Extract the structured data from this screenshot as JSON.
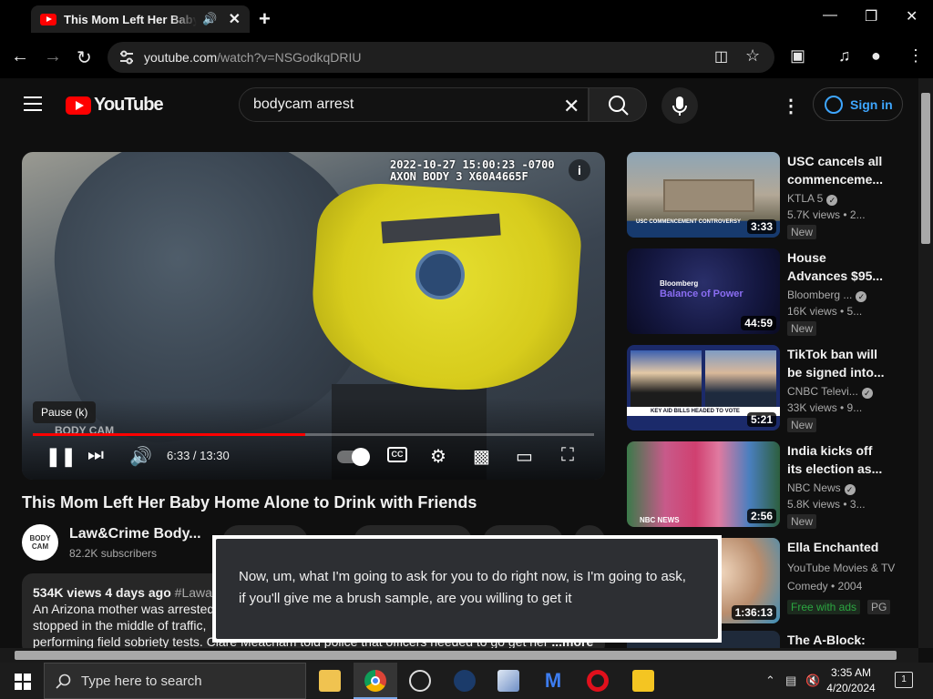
{
  "browser": {
    "tab_title": "This Mom Left Her Baby Home Alone to Drink with Friends",
    "url_host": "youtube.com",
    "url_path": "/watch?v=NSGodkqDRIU"
  },
  "youtube": {
    "logo_text": "YouTube",
    "search_query": "bodycam arrest",
    "sign_in_label": "Sign in"
  },
  "player": {
    "osd_line1": "2022-10-27 15:00:23 -0700",
    "osd_line2": "AXON BODY 3 X60A4665F",
    "tooltip": "Pause (k)",
    "watermark": "BODY CAM",
    "time": "6:33 / 13:30",
    "progress_fraction": 0.485
  },
  "video": {
    "title": "This Mom Left Her Baby Home Alone to Drink with Friends",
    "channel_name": "Law&Crime Body...",
    "channel_subs": "82.2K subscribers",
    "channel_avatar_text": "BODY CAM",
    "desc_meta": "534K views  4 days ago",
    "desc_tag": "#Lawa",
    "desc_line2": "An Arizona mother was arrested",
    "desc_line3": "stopped in the middle of traffic,",
    "desc_line4": "performing field sobriety tests. Clare Meacham told police that officers needed to go get her",
    "desc_more": "...more"
  },
  "caption": {
    "text": "Now, um, what I'm going to ask for you to do right now, is I'm going to ask, if you'll give me a brush sample, are you willing to get it"
  },
  "recommendations": [
    {
      "title1": "USC cancels all",
      "title2": "commenceme...",
      "channel": "KTLA 5",
      "verified": true,
      "meta": "5.7K views  • 2...",
      "badge": "New",
      "duration": "3:33",
      "thumb_caption": "USC COMMENCEMENT CONTROVERSY"
    },
    {
      "title1": "House",
      "title2": "Advances $95...",
      "channel": "Bloomberg ...",
      "verified": true,
      "meta": "16K views  • 5...",
      "badge": "New",
      "duration": "44:59",
      "thumb_caption": "Bloomberg",
      "thumb_caption2": "Balance of Power"
    },
    {
      "title1": "TikTok ban will",
      "title2": "be signed into...",
      "channel": "CNBC Televi...",
      "verified": true,
      "meta": "33K views  • 9...",
      "badge": "New",
      "duration": "5:21",
      "thumb_caption": "KEY AID BILLS HEADED TO VOTE"
    },
    {
      "title1": "India kicks off",
      "title2": "its election as...",
      "channel": "NBC News",
      "verified": true,
      "meta": "5.8K views  • 3...",
      "badge": "New",
      "duration": "2:56",
      "thumb_caption": "NBC NEWS"
    },
    {
      "title1": "Ella Enchanted",
      "title2": "",
      "channel": "YouTube Movies & TV",
      "verified": false,
      "meta": "Comedy • 2004",
      "badge": "Free with ads",
      "badge2": "PG",
      "duration": "1:36:13"
    },
    {
      "title1": "The A-Block:",
      "title2": "",
      "channel": "",
      "verified": false,
      "meta": "",
      "badge": "",
      "duration": ""
    }
  ],
  "taskbar": {
    "search_placeholder": "Type here to search",
    "time": "3:35 AM",
    "date": "4/20/2024",
    "notification_count": "1"
  }
}
